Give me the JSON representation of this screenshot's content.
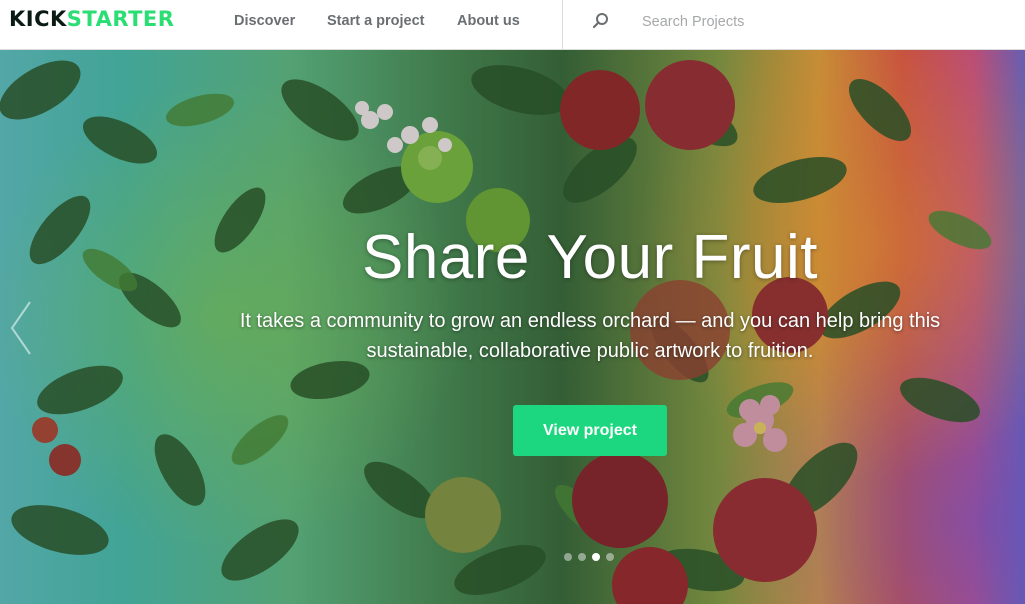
{
  "header": {
    "logo_kick": "KICK",
    "logo_starter": "STARTER",
    "nav": {
      "discover": "Discover",
      "start": "Start a project",
      "about": "About us"
    },
    "search": {
      "placeholder": "Search Projects"
    }
  },
  "hero": {
    "title": "Share Your Fruit",
    "description": "It takes a community to grow an endless orchard — and you can help bring this sustainable, collaborative public artwork to fruition.",
    "button_label": "View project",
    "slides": {
      "count": 4,
      "active_index": 3
    }
  },
  "colors": {
    "brand_green": "#2bde73",
    "button_green": "#1cd77f",
    "nav_text": "#6b6f72"
  },
  "icons": [
    "search-icon",
    "chevron-left-icon"
  ]
}
